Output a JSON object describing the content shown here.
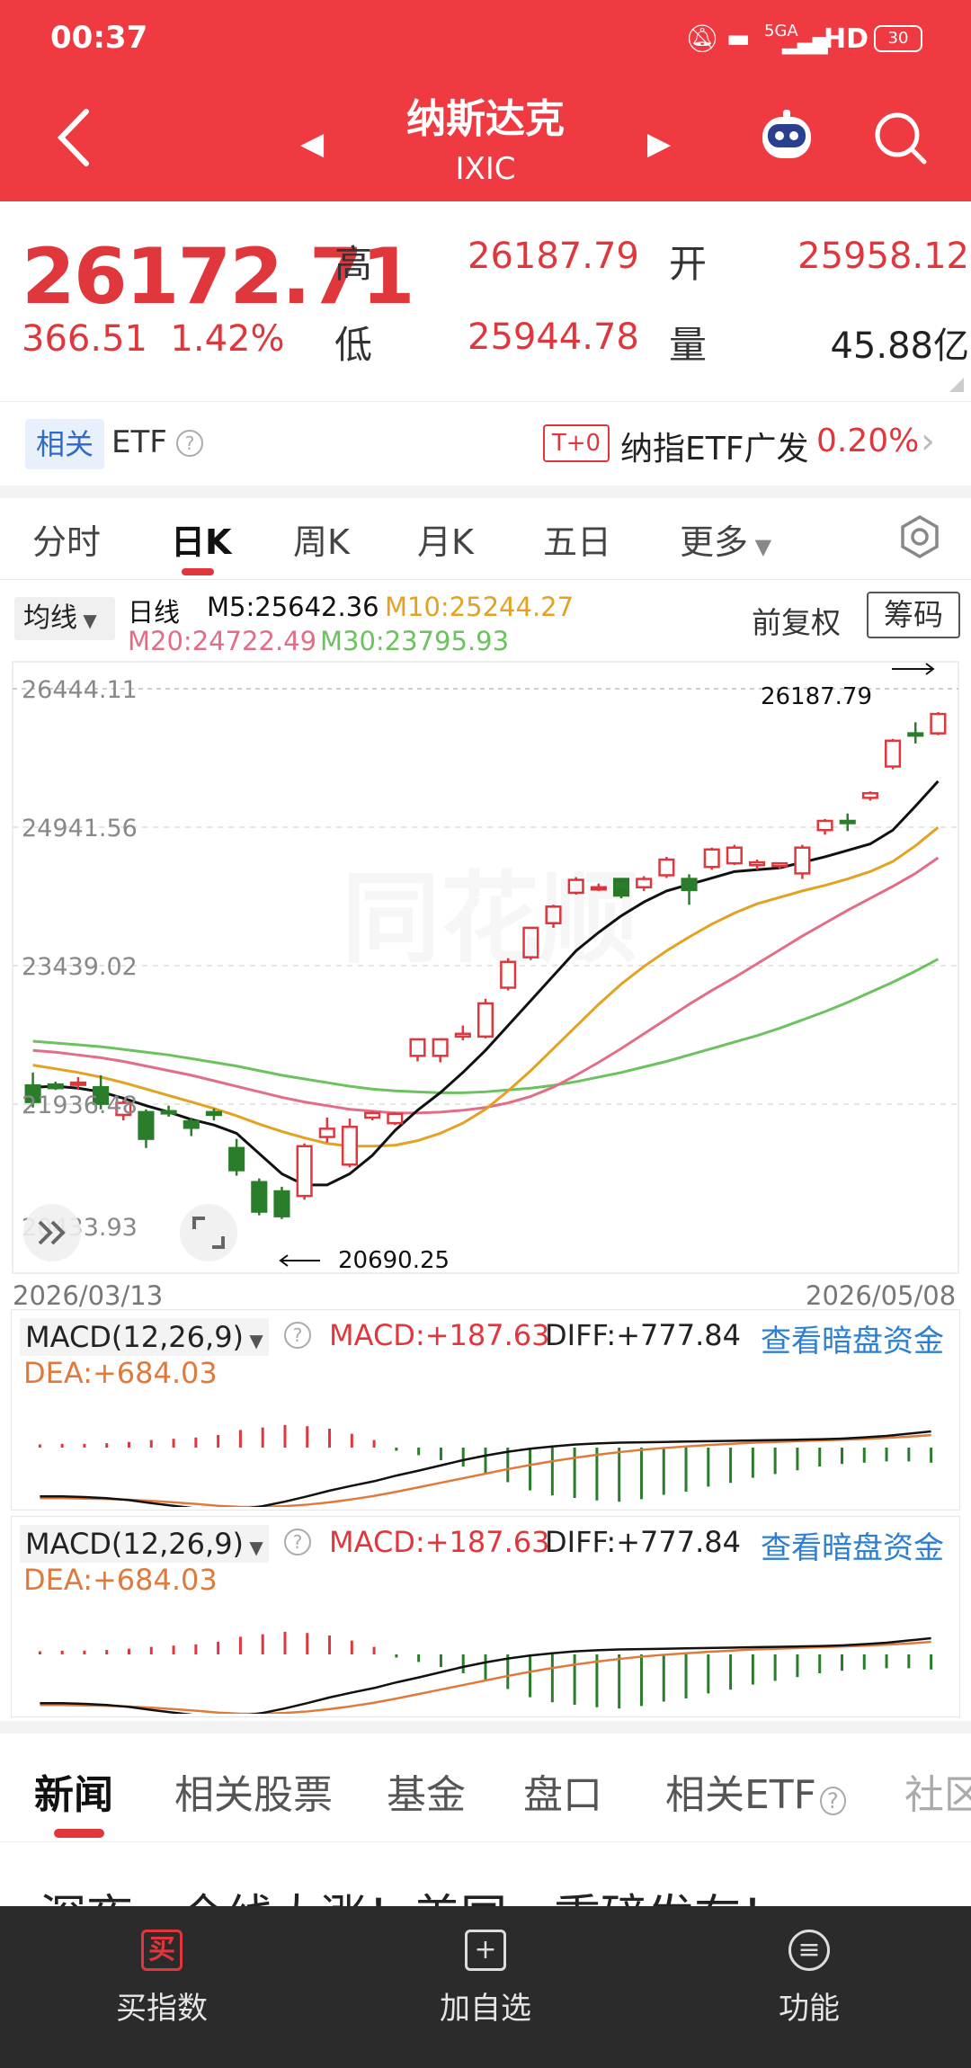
{
  "status": {
    "time": "00:37",
    "network": "5GA",
    "hd": "HD",
    "battery": "30"
  },
  "header": {
    "title": "纳斯达克",
    "subtitle": "IXIC"
  },
  "quote": {
    "price": "26172.71",
    "change": "366.51",
    "change_pct": "1.42%",
    "high_label": "高",
    "high": "26187.79",
    "open_label": "开",
    "open": "25958.12",
    "low_label": "低",
    "low": "25944.78",
    "volume_label": "量",
    "volume": "45.88亿"
  },
  "etf": {
    "tag": "相关",
    "label": "ETF",
    "t0": "T+0",
    "name": "纳指ETF广发",
    "pct": "0.20%"
  },
  "period_tabs": [
    {
      "label": "分时"
    },
    {
      "label": "日K"
    },
    {
      "label": "周K"
    },
    {
      "label": "月K"
    },
    {
      "label": "五日"
    },
    {
      "label": "更多"
    }
  ],
  "period_active": 1,
  "ma": {
    "selector": "均线",
    "type_label": "日线",
    "m5": "M5:25642.36",
    "m10": "M10:25244.27",
    "m20": "M20:24722.49",
    "m30": "M30:23795.93",
    "fq": "前复权",
    "chip": "筹码"
  },
  "colors": {
    "up": "#e0373d",
    "down": "#2a7d2a",
    "m5": "#111111",
    "m10": "#e3a221",
    "m20": "#e36d86",
    "m30": "#6cc25f",
    "accent": "#ee3a40"
  },
  "chart_data": {
    "type": "candlestick",
    "y_ticks": [
      "26444.11",
      "24941.56",
      "23439.02",
      "21936.48",
      "20433.93"
    ],
    "ylim": [
      20433.93,
      26444.11
    ],
    "date_start": "2026/03/13",
    "date_end": "2026/05/08",
    "high_label": "26187.79",
    "low_label": "20690.25",
    "candles": [
      {
        "o": 22140,
        "h": 22280,
        "c": 21960,
        "l": 21900
      },
      {
        "o": 22150,
        "h": 22180,
        "c": 22110,
        "l": 22090
      },
      {
        "o": 22150,
        "h": 22230,
        "c": 22170,
        "l": 22100
      },
      {
        "o": 22120,
        "h": 22250,
        "c": 21940,
        "l": 21880
      },
      {
        "o": 21820,
        "h": 21980,
        "c": 21950,
        "l": 21760
      },
      {
        "o": 21850,
        "h": 21880,
        "c": 21560,
        "l": 21460
      },
      {
        "o": 21860,
        "h": 21920,
        "c": 21850,
        "l": 21800
      },
      {
        "o": 21750,
        "h": 21790,
        "c": 21680,
        "l": 21590
      },
      {
        "o": 21850,
        "h": 21890,
        "c": 21820,
        "l": 21760
      },
      {
        "o": 21460,
        "h": 21560,
        "c": 21220,
        "l": 21160
      },
      {
        "o": 21090,
        "h": 21130,
        "c": 20770,
        "l": 20730
      },
      {
        "o": 20990,
        "h": 21040,
        "c": 20720,
        "l": 20690
      },
      {
        "o": 20940,
        "h": 21510,
        "c": 21480,
        "l": 20900
      },
      {
        "o": 21580,
        "h": 21790,
        "c": 21670,
        "l": 21520
      },
      {
        "o": 21280,
        "h": 21780,
        "c": 21690,
        "l": 21250
      },
      {
        "o": 21790,
        "h": 21860,
        "c": 21840,
        "l": 21760
      },
      {
        "o": 21730,
        "h": 21850,
        "c": 21830,
        "l": 21710
      },
      {
        "o": 22460,
        "h": 22640,
        "c": 22640,
        "l": 22400
      },
      {
        "o": 22460,
        "h": 22650,
        "c": 22640,
        "l": 22390
      },
      {
        "o": 22670,
        "h": 22790,
        "c": 22700,
        "l": 22630
      },
      {
        "o": 22670,
        "h": 23080,
        "c": 23030,
        "l": 22650
      },
      {
        "o": 23200,
        "h": 23520,
        "c": 23480,
        "l": 23170
      },
      {
        "o": 23530,
        "h": 23860,
        "c": 23850,
        "l": 23500
      },
      {
        "o": 23900,
        "h": 24100,
        "c": 24080,
        "l": 23850
      },
      {
        "o": 24230,
        "h": 24400,
        "c": 24370,
        "l": 24210
      },
      {
        "o": 24290,
        "h": 24330,
        "c": 24290,
        "l": 24250
      },
      {
        "o": 24380,
        "h": 24380,
        "c": 24200,
        "l": 24170
      },
      {
        "o": 24290,
        "h": 24410,
        "c": 24380,
        "l": 24250
      },
      {
        "o": 24420,
        "h": 24620,
        "c": 24590,
        "l": 24390
      },
      {
        "o": 24380,
        "h": 24430,
        "c": 24260,
        "l": 24100
      },
      {
        "o": 24510,
        "h": 24720,
        "c": 24700,
        "l": 24480
      },
      {
        "o": 24550,
        "h": 24750,
        "c": 24720,
        "l": 24530
      },
      {
        "o": 24530,
        "h": 24590,
        "c": 24560,
        "l": 24480
      },
      {
        "o": 24520,
        "h": 24560,
        "c": 24550,
        "l": 24490
      },
      {
        "o": 24440,
        "h": 24750,
        "c": 24720,
        "l": 24380
      },
      {
        "o": 24910,
        "h": 25030,
        "c": 25010,
        "l": 24860
      },
      {
        "o": 25010,
        "h": 25090,
        "c": 25000,
        "l": 24900
      },
      {
        "o": 25260,
        "h": 25330,
        "c": 25310,
        "l": 25230
      },
      {
        "o": 25600,
        "h": 25900,
        "c": 25880,
        "l": 25570
      },
      {
        "o": 25960,
        "h": 26080,
        "c": 25940,
        "l": 25850
      },
      {
        "o": 25960,
        "h": 26190,
        "c": 26170,
        "l": 25940
      }
    ],
    "m5": [
      22120,
      22130,
      22110,
      22070,
      22000,
      21920,
      21850,
      21770,
      21710,
      21620,
      21400,
      21180,
      21060,
      21060,
      21180,
      21380,
      21650,
      21870,
      22060,
      22280,
      22520,
      22790,
      23060,
      23330,
      23600,
      23800,
      23980,
      24130,
      24250,
      24320,
      24390,
      24460,
      24480,
      24500,
      24560,
      24620,
      24690,
      24760,
      24910,
      25170,
      25440
    ],
    "m10": [
      22360,
      22320,
      22280,
      22230,
      22170,
      22100,
      22030,
      21960,
      21890,
      21810,
      21720,
      21640,
      21570,
      21510,
      21480,
      21480,
      21490,
      21540,
      21620,
      21730,
      21880,
      22080,
      22300,
      22540,
      22780,
      23020,
      23240,
      23430,
      23600,
      23750,
      23890,
      24010,
      24110,
      24180,
      24250,
      24310,
      24380,
      24460,
      24570,
      24740,
      24940
    ],
    "m20": [
      22520,
      22500,
      22470,
      22440,
      22400,
      22350,
      22300,
      22250,
      22190,
      22130,
      22070,
      22010,
      21960,
      21920,
      21880,
      21860,
      21840,
      21840,
      21850,
      21870,
      21900,
      21950,
      22020,
      22120,
      22250,
      22390,
      22540,
      22700,
      22860,
      23020,
      23170,
      23310,
      23460,
      23610,
      23760,
      23900,
      24040,
      24170,
      24300,
      24440,
      24610
    ],
    "m30": [
      22620,
      22600,
      22580,
      22560,
      22530,
      22500,
      22470,
      22430,
      22390,
      22350,
      22300,
      22250,
      22210,
      22170,
      22130,
      22100,
      22080,
      22070,
      22060,
      22060,
      22070,
      22090,
      22110,
      22140,
      22180,
      22230,
      22280,
      22340,
      22400,
      22470,
      22540,
      22610,
      22680,
      22760,
      22850,
      22940,
      23040,
      23150,
      23260,
      23380,
      23510
    ]
  },
  "macd": {
    "selector": "MACD(12,26,9)",
    "macd_value": "MACD:+187.63",
    "diff_value": "DIFF:+777.84",
    "dea_value": "DEA:+684.03",
    "link": "查看暗盘资金",
    "hist": [
      0.05,
      0.06,
      0.06,
      0.07,
      0.09,
      0.12,
      0.14,
      0.16,
      0.2,
      0.28,
      0.32,
      0.36,
      0.34,
      0.3,
      0.22,
      0.12,
      -0.05,
      -0.12,
      -0.2,
      -0.3,
      -0.4,
      -0.55,
      -0.68,
      -0.76,
      -0.8,
      -0.84,
      -0.86,
      -0.82,
      -0.75,
      -0.7,
      -0.62,
      -0.56,
      -0.48,
      -0.42,
      -0.36,
      -0.3,
      -0.26,
      -0.24,
      -0.22,
      -0.22,
      -0.24
    ],
    "diff": [
      -0.1,
      -0.1,
      -0.12,
      -0.15,
      -0.2,
      -0.28,
      -0.35,
      -0.42,
      -0.46,
      -0.44,
      -0.36,
      -0.24,
      -0.1,
      0.05,
      0.18,
      0.3,
      0.45,
      0.58,
      0.72,
      0.86,
      0.98,
      1.08,
      1.16,
      1.22,
      1.27,
      1.3,
      1.32,
      1.33,
      1.34,
      1.35,
      1.36,
      1.37,
      1.38,
      1.39,
      1.4,
      1.41,
      1.43,
      1.46,
      1.5,
      1.56,
      1.62
    ],
    "dea": [
      -0.15,
      -0.15,
      -0.16,
      -0.17,
      -0.19,
      -0.22,
      -0.26,
      -0.3,
      -0.35,
      -0.38,
      -0.38,
      -0.36,
      -0.32,
      -0.26,
      -0.18,
      -0.09,
      0.02,
      0.14,
      0.26,
      0.38,
      0.5,
      0.62,
      0.73,
      0.83,
      0.92,
      1,
      1.07,
      1.13,
      1.18,
      1.22,
      1.26,
      1.29,
      1.32,
      1.34,
      1.36,
      1.38,
      1.4,
      1.42,
      1.45,
      1.48,
      1.52
    ]
  },
  "news_tabs": [
    {
      "label": "新闻"
    },
    {
      "label": "相关股票"
    },
    {
      "label": "基金"
    },
    {
      "label": "盘口"
    },
    {
      "label": "相关ETF"
    },
    {
      "label": "社区"
    }
  ],
  "headline": "深夜，全线大涨！美国，重磅发布！",
  "bottom_bar": [
    {
      "label": "买指数",
      "icon": "买"
    },
    {
      "label": "加自选",
      "icon": "+"
    },
    {
      "label": "功能",
      "icon": "≡"
    }
  ]
}
